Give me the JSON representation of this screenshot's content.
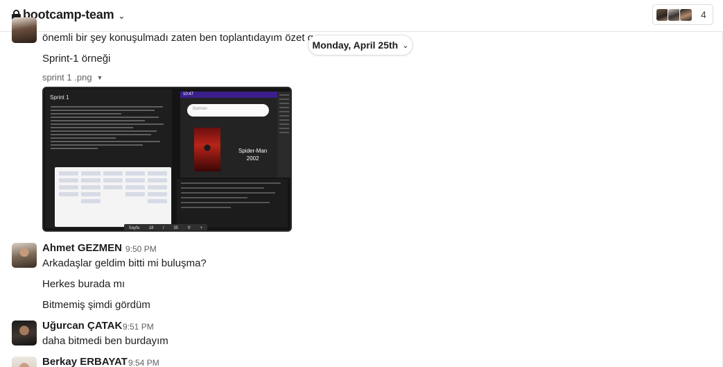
{
  "header": {
    "channel_name": "bootcamp-team",
    "member_count": "4"
  },
  "date_divider": {
    "label": "Monday, April 25th"
  },
  "messages": [
    {
      "text": "önemli bir şey konuşulmadı zaten ben toplantıdayım özet geç"
    },
    {
      "text": "Sprint-1 örneği"
    }
  ],
  "attachment": {
    "file_name": "sprint 1 .png",
    "preview": {
      "doc_title": "Sprint 1",
      "search_placeholder": "Batman",
      "movie_title_line1": "Spider-Man",
      "movie_title_line2": "2002",
      "status_time": "10:47",
      "pager_label": "Sayfa",
      "pager_current": "18",
      "pager_separator": "/",
      "pager_total": "35"
    }
  },
  "groups": [
    {
      "sender": "Ahmet GEZMEN",
      "time": "9:50 PM",
      "lines": [
        "Arkadaşlar geldim bitti mi buluşma?",
        "Herkes burada mı",
        "Bitmemiş şimdi gördüm"
      ]
    },
    {
      "sender": "Uğurcan ÇATAK",
      "time": "9:51 PM",
      "lines": [
        "daha bitmedi ben burdayım"
      ]
    },
    {
      "sender": "Berkay ERBAYAT",
      "time": "9:54 PM",
      "lines": []
    }
  ],
  "icons": {
    "lock": "lock-icon",
    "channel_chevron": "chevron-down-icon",
    "date_chevron": "chevron-down-icon",
    "file_chevron": "caret-down-icon"
  }
}
